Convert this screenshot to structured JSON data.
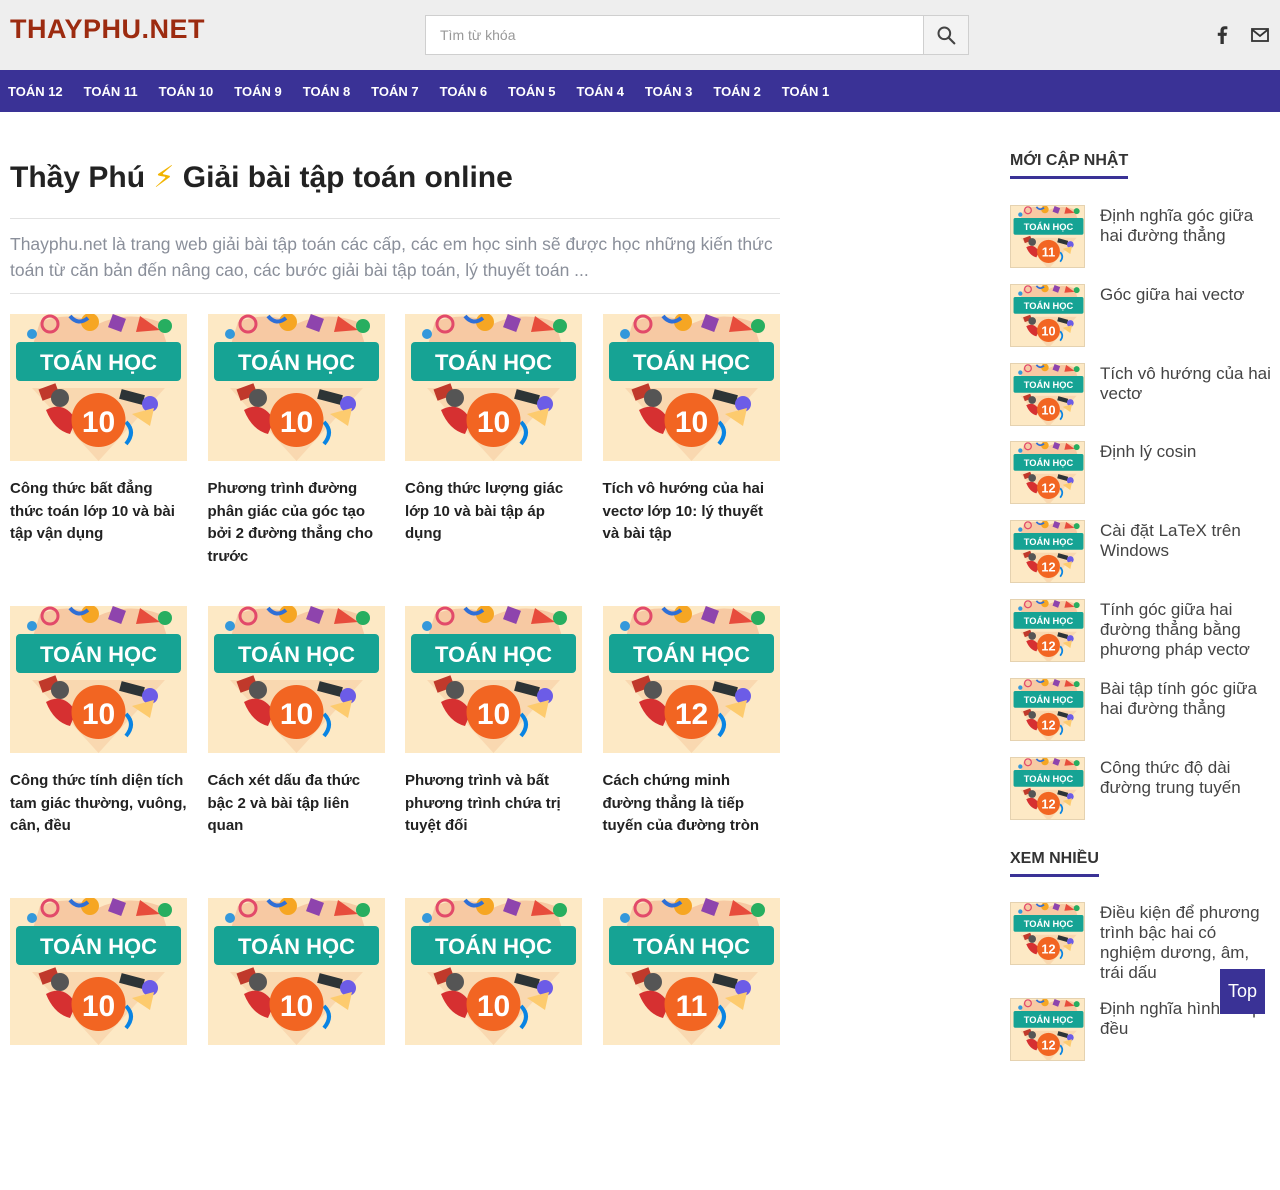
{
  "header": {
    "logo": "THAYPHU.NET",
    "search": {
      "placeholder": "Tìm từ khóa",
      "value": ""
    }
  },
  "nav": {
    "items": [
      "TOÁN 12",
      "TOÁN 11",
      "TOÁN 10",
      "TOÁN 9",
      "TOÁN 8",
      "TOÁN 7",
      "TOÁN 6",
      "TOÁN 5",
      "TOÁN 4",
      "TOÁN 3",
      "TOÁN 2",
      "TOÁN 1"
    ]
  },
  "main": {
    "title_left": "Thầy Phú",
    "title_right": "Giải bài tập toán online",
    "intro": "Thayphu.net là trang web giải bài tập toán các cấp, các em học sinh sẽ được học những kiến thức toán từ căn bản đến nâng cao, các bước giải bài tập toán, lý thuyết toán ...",
    "thumb_label": "TOÁN HỌC",
    "posts": [
      {
        "title": "Công thức bất đẳng thức toán lớp 10 và bài tập vận dụng",
        "grade": "10"
      },
      {
        "title": "Phương trình đường phân giác của góc tạo bởi 2 đường thẳng cho trước",
        "grade": "10"
      },
      {
        "title": "Công thức lượng giác lớp 10 và bài tập áp dụng",
        "grade": "10"
      },
      {
        "title": "Tích vô hướng của hai vectơ lớp 10: lý thuyết và bài tập",
        "grade": "10"
      },
      {
        "title": "Công thức tính diện tích tam giác thường, vuông, cân, đều",
        "grade": "10"
      },
      {
        "title": "Cách xét dấu đa thức bậc 2 và bài tập liên quan",
        "grade": "10"
      },
      {
        "title": "Phương trình và bất phương trình chứa trị tuyệt đối",
        "grade": "10"
      },
      {
        "title": "Cách chứng minh đường thẳng là tiếp tuyến của đường tròn",
        "grade": "12"
      },
      {
        "title": "",
        "grade": "10"
      },
      {
        "title": "",
        "grade": "10"
      },
      {
        "title": "",
        "grade": "10"
      },
      {
        "title": "",
        "grade": "11"
      }
    ]
  },
  "sidebar": {
    "recent_heading": "MỚI CẬP NHẬT",
    "recent": [
      {
        "title": "Định nghĩa góc giữa hai đường thẳng",
        "grade": "11"
      },
      {
        "title": "Góc giữa hai vectơ",
        "grade": "10"
      },
      {
        "title": "Tích vô hướng của hai vectơ",
        "grade": "10"
      },
      {
        "title": "Định lý cosin",
        "grade": "12"
      },
      {
        "title": "Cài đặt LaTeX trên Windows",
        "grade": "12"
      },
      {
        "title": "Tính góc giữa hai đường thẳng bằng phương pháp vectơ",
        "grade": "12"
      },
      {
        "title": "Bài tập tính góc giữa hai đường thẳng",
        "grade": "12"
      },
      {
        "title": "Công thức độ dài đường trung tuyến",
        "grade": "12"
      }
    ],
    "popular_heading": "XEM NHIỀU",
    "popular": [
      {
        "title": "Điều kiện để phương trình bậc hai có nghiệm dương, âm, trái dấu",
        "grade": "12"
      },
      {
        "title": "Định nghĩa hình chóp đều",
        "grade": "12"
      }
    ]
  },
  "top_button": "Top",
  "colors": {
    "brand": "#9c2b10",
    "nav": "#3a3296",
    "thumb_bg": "#fde9c5",
    "thumb_banner": "#16a394",
    "thumb_badge": "#f26522"
  }
}
